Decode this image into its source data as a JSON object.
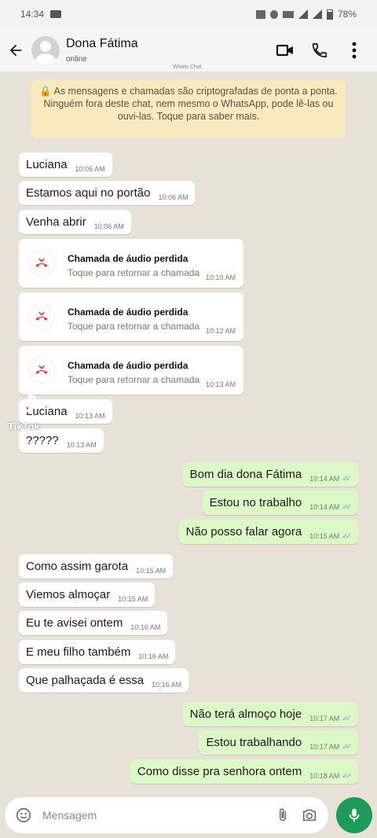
{
  "statusbar": {
    "time": "14:34",
    "battery": "78%"
  },
  "header": {
    "contact_name": "Dona Fátima",
    "contact_status": "online",
    "subtitle_watermark": "Whats Chat",
    "icons": [
      "back-arrow-icon",
      "avatar",
      "video-call-icon",
      "phone-icon",
      "more-options-icon"
    ]
  },
  "notice": {
    "text": "🔒 As mensagens e chamadas são criptografadas de ponta a ponta. Ninguém fora deste chat, nem mesmo o WhatsApp, pode lê-las ou ouvi-las. Toque para saber mais."
  },
  "messages": [
    {
      "dir": "in",
      "text": "Luciana",
      "time": "10:06 AM"
    },
    {
      "dir": "in",
      "text": "Estamos aqui no portão",
      "time": "10:06 AM"
    },
    {
      "dir": "in",
      "text": "Venha abrir",
      "time": "10:06 AM"
    },
    {
      "dir": "in",
      "type": "missed-call",
      "title": "Chamada de áudio perdida",
      "sub": "Toque para retornar a chamada",
      "time": "10:10 AM"
    },
    {
      "dir": "in",
      "type": "missed-call",
      "title": "Chamada de áudio perdida",
      "sub": "Toque para retornar a chamada",
      "time": "10:12 AM"
    },
    {
      "dir": "in",
      "type": "missed-call",
      "title": "Chamada de áudio perdida",
      "sub": "Toque para retornar a chamada",
      "time": "10:13 AM"
    },
    {
      "dir": "in",
      "text": "Luciana",
      "time": "10:13 AM"
    },
    {
      "dir": "in",
      "text": "?????",
      "time": "10:13 AM"
    },
    {
      "dir": "out",
      "text": "Bom dia dona Fátima",
      "time": "10:14 AM"
    },
    {
      "dir": "out",
      "text": "Estou no trabalho",
      "time": "10:14 AM"
    },
    {
      "dir": "out",
      "text": "Não posso falar agora",
      "time": "10:15 AM"
    },
    {
      "dir": "in",
      "text": "Como assim garota",
      "time": "10:15 AM"
    },
    {
      "dir": "in",
      "text": "Viemos almoçar",
      "time": "10:15 AM"
    },
    {
      "dir": "in",
      "text": "Eu te avisei ontem",
      "time": "10:16 AM"
    },
    {
      "dir": "in",
      "text": "E meu filho também",
      "time": "10:16 AM"
    },
    {
      "dir": "in",
      "text": "Que palhaçada é essa",
      "time": "10:16 AM"
    },
    {
      "dir": "out",
      "text": "Não terá almoço hoje",
      "time": "10:17 AM"
    },
    {
      "dir": "out",
      "text": "Estou trabalhando",
      "time": "10:17 AM"
    },
    {
      "dir": "out",
      "text": "Como disse pra senhora ontem",
      "time": "10:18 AM"
    }
  ],
  "tiktok": {
    "label": "TikTok"
  },
  "composer": {
    "placeholder": "Mensagem",
    "icons": [
      "emoji-icon",
      "attach-icon",
      "camera-icon",
      "mic-icon"
    ]
  },
  "colors": {
    "incoming": "#ffffff",
    "outgoing": "#dcf8c6",
    "accent": "#1f9b59",
    "read_ticks": "#4fb6ec"
  }
}
